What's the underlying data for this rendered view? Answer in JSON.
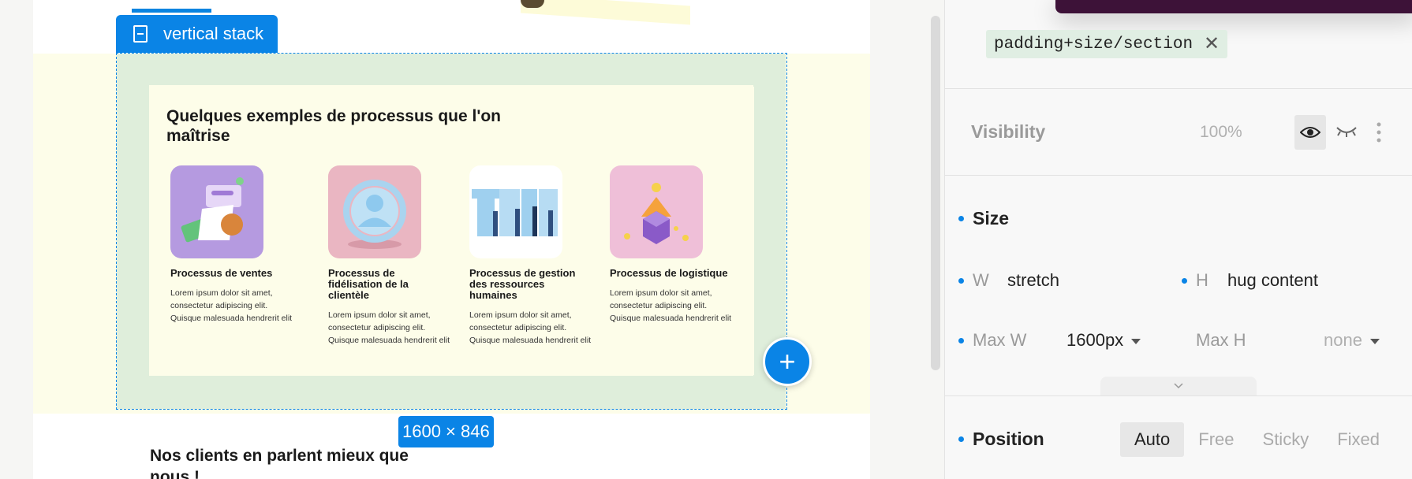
{
  "canvas": {
    "stack_label": "vertical stack",
    "section_title": "Quelques exemples de processus que l'on maîtrise",
    "cards": [
      {
        "title": "Processus de ventes",
        "desc": "Lorem ipsum dolor sit amet, consectetur adipiscing elit. Quisque malesuada hendrerit elit",
        "image": "sales-illustration"
      },
      {
        "title": "Processus de fidélisation de la clientèle",
        "desc": "Lorem ipsum dolor sit amet, consectetur adipiscing elit. Quisque malesuada hendrerit elit",
        "image": "profile-illustration"
      },
      {
        "title": "Processus de gestion des ressources humaines",
        "desc": "Lorem ipsum dolor sit amet, consectetur adipiscing elit. Quisque malesuada hendrerit elit",
        "image": "team-illustration"
      },
      {
        "title": "Processus de logistique",
        "desc": "Lorem ipsum dolor sit amet, consectetur adipiscing elit. Quisque malesuada hendrerit elit",
        "image": "box-illustration"
      }
    ],
    "size_badge": "1600 × 846",
    "add_button": "+",
    "next_section_title": "Nos clients en parlent mieux que nous !"
  },
  "inspector": {
    "tag": "padding+size/section",
    "tag_remove": "✕",
    "visibility": {
      "label": "Visibility",
      "value": "100%"
    },
    "size": {
      "heading": "Size",
      "w_label": "W",
      "w_value": "stretch",
      "h_label": "H",
      "h_value": "hug content",
      "maxw_label": "Max W",
      "maxw_value": "1600px",
      "maxh_label": "Max H",
      "maxh_value": "none"
    },
    "position": {
      "heading": "Position",
      "options": [
        "Auto",
        "Free",
        "Sticky",
        "Fixed"
      ],
      "selected": "Auto"
    }
  },
  "colors": {
    "accent": "#0a84e6",
    "padding_overlay": "#dfeedb",
    "section_bg": "#fdfde9"
  }
}
